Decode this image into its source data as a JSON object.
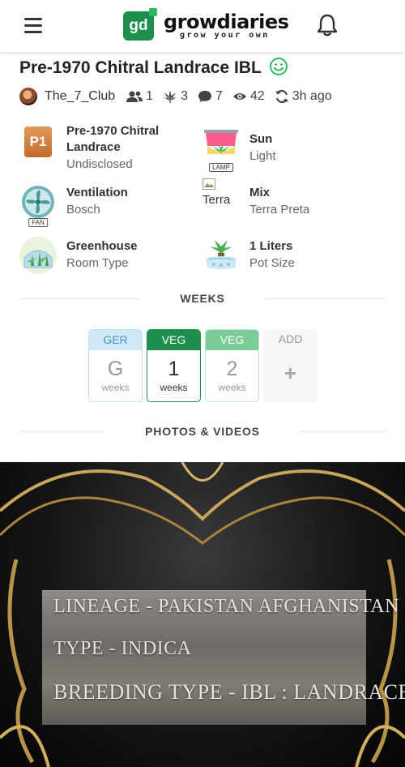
{
  "header": {
    "logo_mark": "gd",
    "logo_name": "growdiaries",
    "logo_tagline": "grow your own"
  },
  "diary": {
    "title": "Pre-1970 Chitral Landrace IBL",
    "author": "The_7_Club",
    "followers": "1",
    "plants": "3",
    "comments": "7",
    "views": "42",
    "updated": "3h ago"
  },
  "info": {
    "strain": {
      "icon_text": "P1",
      "label": "Pre-1970 Chitral Landrace",
      "sub": "Undisclosed"
    },
    "lamp": {
      "badge": "LAMP",
      "label": "Sun",
      "sub": "Light"
    },
    "fan": {
      "badge": "FAN",
      "label": "Ventilation",
      "sub": "Bosch"
    },
    "medium": {
      "alt": "Terra",
      "label": "Mix",
      "sub": "Terra Preta"
    },
    "room": {
      "label": "Greenhouse",
      "sub": "Room Type"
    },
    "pot": {
      "label": "1 Liters",
      "sub": "Pot Size"
    }
  },
  "weeks_section": {
    "heading": "WEEKS",
    "weeks": [
      {
        "stage": "GER",
        "value": "G",
        "unit": "weeks"
      },
      {
        "stage": "VEG",
        "value": "1",
        "unit": "weeks"
      },
      {
        "stage": "VEG",
        "value": "2",
        "unit": "weeks"
      }
    ],
    "add_label": "ADD",
    "add_icon": "+"
  },
  "photos_section": {
    "heading": "PHOTOS & VIDEOS"
  },
  "media": {
    "lines": [
      "LINEAGE - PAKISTAN AFGHANISTAN",
      "TYPE - INDICA",
      "BREEDING TYPE - IBL : LANDRACE"
    ]
  },
  "colors": {
    "brand_green": "#1f8f4e",
    "ger_blue": "#cde8f8",
    "veg_light": "#7ccc9a"
  },
  "icons": {
    "menu": "hamburger-menu-icon",
    "notifications": "bell-icon",
    "followers": "users-icon",
    "plants": "cannabis-leaf-icon",
    "comments": "comment-icon",
    "views": "eye-icon",
    "updated": "refresh-icon",
    "status": "smile-icon"
  }
}
